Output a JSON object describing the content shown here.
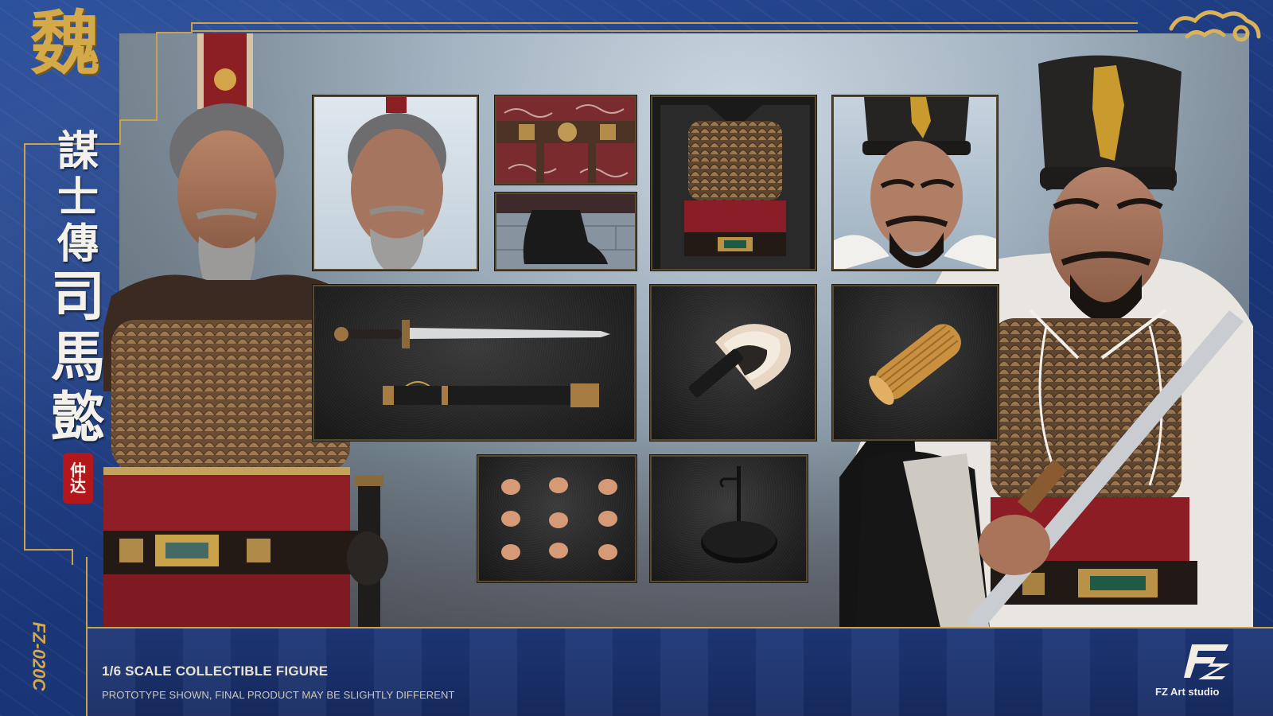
{
  "header": {
    "kingdom_char": "魏"
  },
  "title": {
    "line_small": [
      "謀",
      "士",
      "傳"
    ],
    "line_big": [
      "司",
      "馬",
      "懿"
    ],
    "seal_chars": [
      "仲",
      "达"
    ]
  },
  "product_code": "FZ-020C",
  "footer": {
    "scale": "1/6 SCALE COLLECTIBLE FIGURE",
    "disclaimer": "PROTOTYPE SHOWN, FINAL PRODUCT MAY BE SLIGHTLY DIFFERENT",
    "brand": "FZ Art studio"
  },
  "accessories": {
    "tiles": [
      "head-sculpt-elder",
      "belt-detail",
      "boot-detail",
      "armor-detail",
      "head-sculpt-young",
      "sword-and-scabbard",
      "feather-fan",
      "bamboo-scroll",
      "interchangeable-hands",
      "display-stand"
    ]
  },
  "colors": {
    "gold": "#c9a24a",
    "navy": "#1b3677",
    "seal_red": "#b3171b"
  }
}
